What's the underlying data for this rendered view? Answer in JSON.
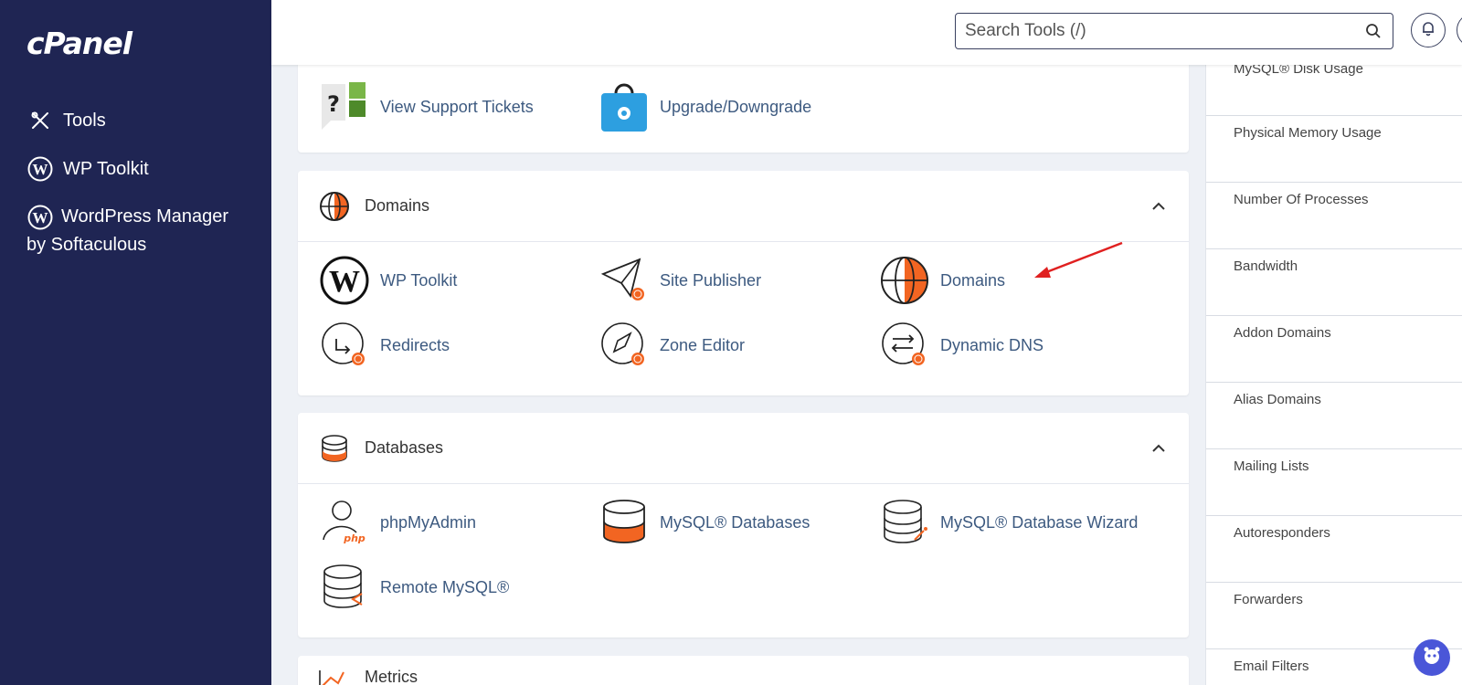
{
  "brand": {
    "logo_text": "cPanel"
  },
  "sidebar": {
    "items": [
      {
        "label": "Tools",
        "icon": "tools-icon"
      },
      {
        "label": "WP Toolkit",
        "icon": "wordpress-icon"
      },
      {
        "label": "WordPress Manager by Softaculous",
        "icon": "wordpress-icon"
      }
    ]
  },
  "header": {
    "search_placeholder": "Search Tools (/)"
  },
  "top_section": {
    "tools": [
      {
        "label": "View Support Tickets",
        "icon": "support-tickets-icon"
      },
      {
        "label": "Upgrade/Downgrade",
        "icon": "upgrade-bag-icon"
      }
    ]
  },
  "domains_section": {
    "title": "Domains",
    "tools": [
      {
        "label": "WP Toolkit",
        "icon": "wordpress-icon"
      },
      {
        "label": "Site Publisher",
        "icon": "paper-plane-icon"
      },
      {
        "label": "Domains",
        "icon": "globe-icon"
      },
      {
        "label": "Redirects",
        "icon": "redirect-icon"
      },
      {
        "label": "Zone Editor",
        "icon": "rocket-icon"
      },
      {
        "label": "Dynamic DNS",
        "icon": "swap-arrows-icon"
      }
    ]
  },
  "databases_section": {
    "title": "Databases",
    "tools": [
      {
        "label": "phpMyAdmin",
        "icon": "phpmyadmin-icon"
      },
      {
        "label": "MySQL® Databases",
        "icon": "database-icon"
      },
      {
        "label": "MySQL® Database Wizard",
        "icon": "database-wizard-icon"
      },
      {
        "label": "Remote MySQL®",
        "icon": "remote-database-icon"
      }
    ]
  },
  "metrics_section": {
    "title": "Metrics"
  },
  "stats": {
    "items": [
      {
        "label": "MySQL® Disk Usage"
      },
      {
        "label": "Physical Memory Usage"
      },
      {
        "label": "Number Of Processes"
      },
      {
        "label": "Bandwidth"
      },
      {
        "label": "Addon Domains"
      },
      {
        "label": "Alias Domains"
      },
      {
        "label": "Mailing Lists"
      },
      {
        "label": "Autoresponders"
      },
      {
        "label": "Forwarders"
      },
      {
        "label": "Email Filters"
      }
    ]
  },
  "colors": {
    "sidebar_bg": "#1f2553",
    "accent_orange": "#f26522",
    "link_blue": "#3d5a80",
    "annotation_red": "#e02020"
  }
}
